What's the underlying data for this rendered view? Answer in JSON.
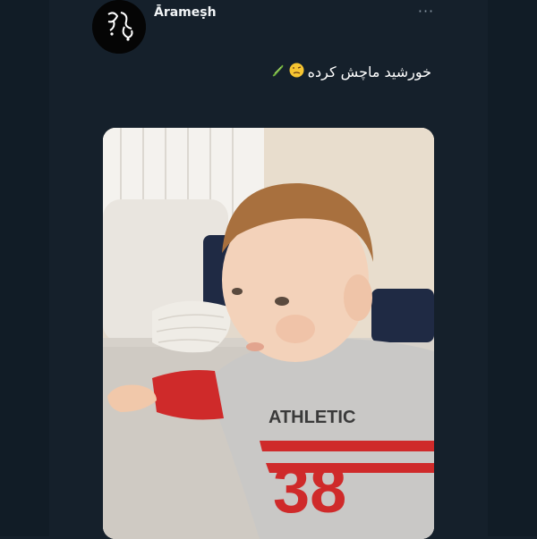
{
  "tweet": {
    "author": {
      "display_name": "Ārameṣh",
      "avatar_icon": "calligraphy-avatar-icon"
    },
    "more_label": "···",
    "text": "خورشید ماچش کرده",
    "emojis": [
      "cucumber-emoji",
      "woozy-face-emoji"
    ],
    "photo": {
      "description_icon": "toddler-photo",
      "shirt_text": "ATHLETIC",
      "shirt_number": "38"
    }
  },
  "colors": {
    "background": "#15202b",
    "text": "#ffffff",
    "muted": "#8b98a5"
  }
}
